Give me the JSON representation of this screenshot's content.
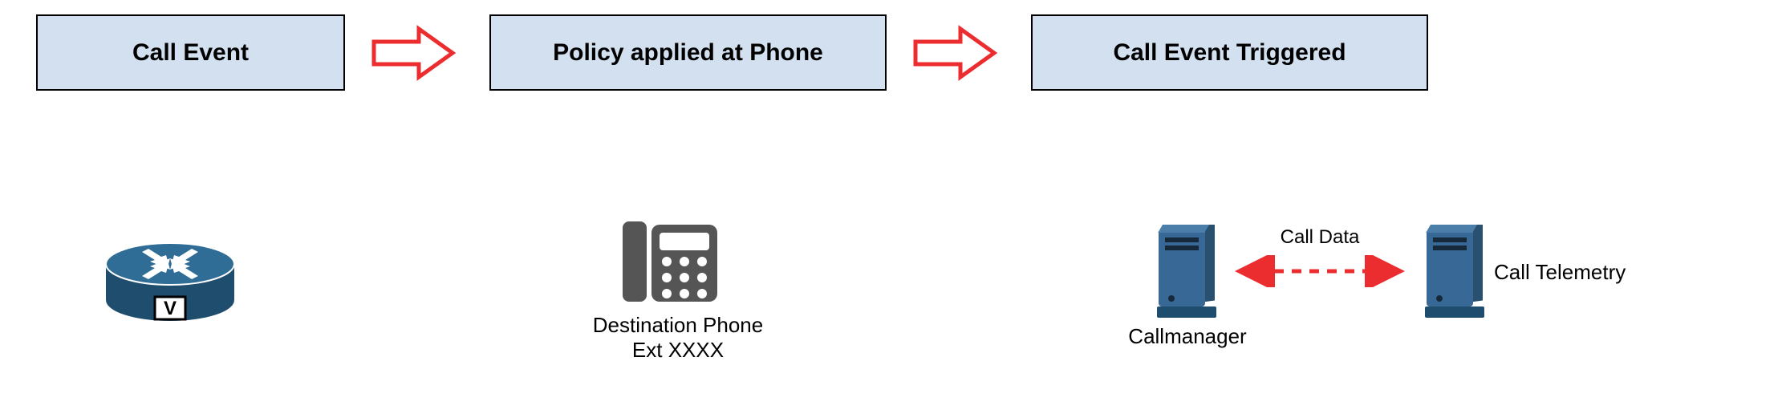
{
  "boxes": {
    "call_event": "Call Event",
    "policy": "Policy applied at Phone",
    "triggered": "Call Event Triggered"
  },
  "labels": {
    "dest_phone_l1": "Destination Phone",
    "dest_phone_l2": "Ext XXXX",
    "callmanager": "Callmanager",
    "call_telemetry": "Call Telemetry",
    "call_data": "Call Data"
  },
  "icons": {
    "router": "router-icon",
    "phone": "phone-icon",
    "server_left": "server-icon",
    "server_right": "server-icon"
  },
  "colors": {
    "box_fill": "#d2e0ef",
    "arrow": "#ec2d2f",
    "server_fill": "#386895",
    "server_shadow": "#2a506f",
    "phone": "#555555",
    "router": "#2f6c96"
  }
}
